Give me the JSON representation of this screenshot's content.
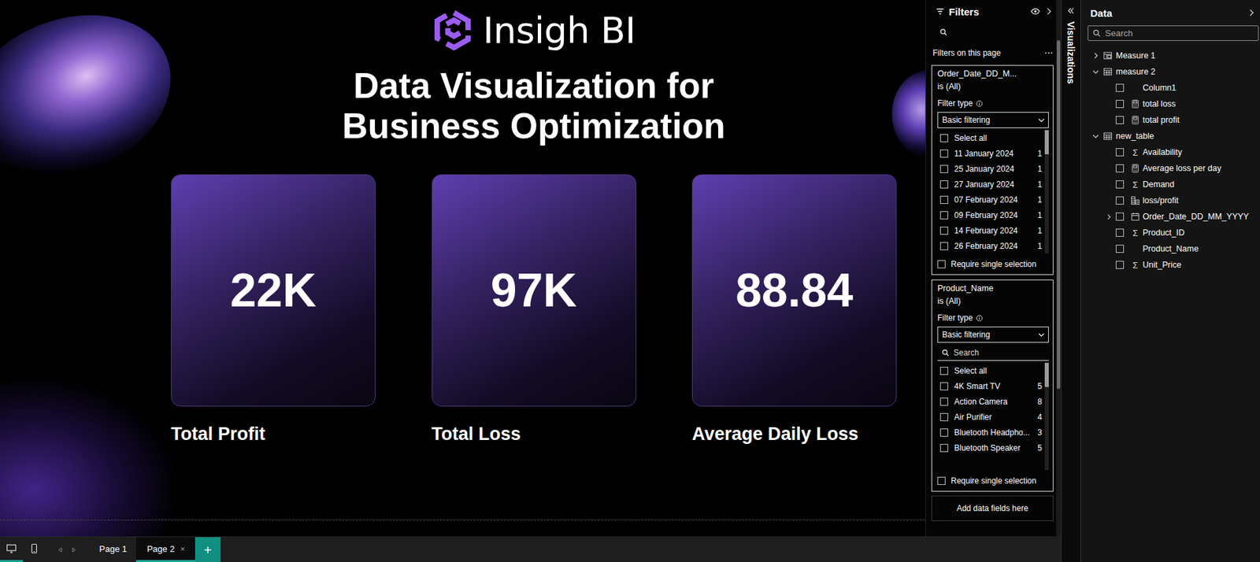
{
  "report": {
    "logo": {
      "text": "Insigh BI"
    },
    "title": [
      "Data Visualization for",
      "Business Optimization"
    ],
    "cards": [
      {
        "value": "22K",
        "label": "Total Profit"
      },
      {
        "value": "97K",
        "label": "Total Loss"
      },
      {
        "value": "88.84",
        "label": "Average Daily Loss"
      }
    ]
  },
  "filters": {
    "title": "Filters",
    "section": "Filters on this page",
    "cards": [
      {
        "field": "Order_Date_DD_M...",
        "condition": "is (All)",
        "type_label": "Filter type",
        "type": "Basic filtering",
        "items": [
          {
            "label": "Select all",
            "count": "",
            "checked": false
          },
          {
            "label": "11 January 2024",
            "count": "1",
            "checked": false
          },
          {
            "label": "25 January 2024",
            "count": "1",
            "checked": false
          },
          {
            "label": "27 January 2024",
            "count": "1",
            "checked": false
          },
          {
            "label": "07 February 2024",
            "count": "1",
            "checked": false
          },
          {
            "label": "09 February 2024",
            "count": "1",
            "checked": false
          },
          {
            "label": "14 February 2024",
            "count": "1",
            "checked": false
          },
          {
            "label": "26 February 2024",
            "count": "1",
            "checked": false
          }
        ],
        "require": {
          "label": "Require single selection",
          "checked": false
        }
      },
      {
        "field": "Product_Name",
        "condition": "is (All)",
        "type_label": "Filter type",
        "type": "Basic filtering",
        "search": {
          "placeholder": "Search"
        },
        "items": [
          {
            "label": "Select all",
            "count": "",
            "checked": false
          },
          {
            "label": "4K Smart TV",
            "count": "5",
            "checked": false
          },
          {
            "label": "Action Camera",
            "count": "8",
            "checked": false
          },
          {
            "label": "Air Purifier",
            "count": "4",
            "checked": false
          },
          {
            "label": "Bluetooth Headpho...",
            "count": "3",
            "checked": false
          },
          {
            "label": "Bluetooth Speaker",
            "count": "5",
            "checked": false
          }
        ],
        "require": {
          "label": "Require single selection",
          "checked": false
        }
      }
    ],
    "add_fields": "Add data fields here"
  },
  "visualizations": {
    "label": "Visualizations"
  },
  "data": {
    "title": "Data",
    "search": {
      "placeholder": "Search"
    },
    "tree": [
      {
        "label": "Measure 1",
        "kind": "measure-table",
        "expanded": false,
        "children": []
      },
      {
        "label": "measure 2",
        "kind": "table",
        "expanded": true,
        "children": [
          {
            "label": "Column1",
            "kind": "column",
            "checked": false
          },
          {
            "label": "total loss",
            "kind": "measure",
            "checked": false
          },
          {
            "label": "total profit",
            "kind": "measure",
            "checked": false
          }
        ]
      },
      {
        "label": "new_table",
        "kind": "table",
        "expanded": true,
        "children": [
          {
            "label": "Availability",
            "kind": "sum",
            "icon": "Σ",
            "checked": false
          },
          {
            "label": "Average loss per day",
            "kind": "measure",
            "checked": false
          },
          {
            "label": "Demand",
            "kind": "sum",
            "icon": "Σ",
            "checked": false
          },
          {
            "label": "loss/profit",
            "kind": "calc-column",
            "checked": false
          },
          {
            "label": "Order_Date_DD_MM_YYYY",
            "kind": "hierarchy",
            "expanded": false,
            "checked": false
          },
          {
            "label": "Product_ID",
            "kind": "sum",
            "icon": "Σ",
            "checked": false
          },
          {
            "label": "Product_Name",
            "kind": "column",
            "checked": false
          },
          {
            "label": "Unit_Price",
            "kind": "sum",
            "icon": "Σ",
            "checked": false
          }
        ]
      }
    ]
  },
  "pages": {
    "views": [
      {
        "kind": "desktop",
        "selected": true
      },
      {
        "kind": "mobile",
        "selected": false
      }
    ],
    "tabs": [
      {
        "label": "Page 1",
        "selected": false
      },
      {
        "label": "Page 2",
        "selected": true
      }
    ]
  }
}
